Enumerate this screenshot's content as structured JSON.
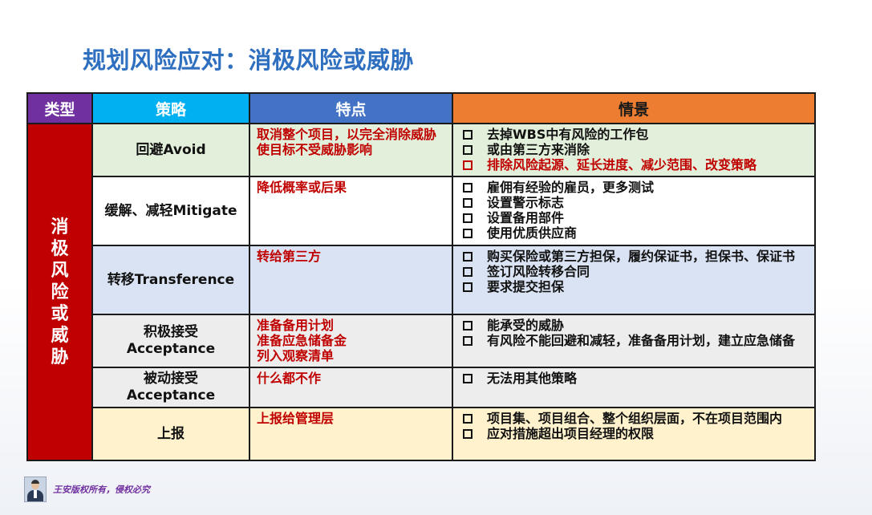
{
  "title": "规划风险应对：消极风险或威胁",
  "table": {
    "headers": {
      "type": "类型",
      "strategy": "策略",
      "feature": "特点",
      "scenario": "情景"
    },
    "type_label": "消极风险或威胁",
    "rows": [
      {
        "strategy": "回避Avoid",
        "features": [
          "取消整个项目，以完全消除威胁",
          "使目标不受威胁影响"
        ],
        "scenarios": [
          {
            "text": "去掉WBS中有风险的工作包",
            "highlight": false
          },
          {
            "text": "或由第三方来消除",
            "highlight": false
          },
          {
            "text": "排除风险起源、延长进度、减少范围、改变策略",
            "highlight": true
          }
        ]
      },
      {
        "strategy": "缓解、减轻Mitigate",
        "features": [
          "降低概率或后果"
        ],
        "scenarios": [
          {
            "text": "雇佣有经验的雇员，更多测试"
          },
          {
            "text": "设置警示标志"
          },
          {
            "text": "设置备用部件"
          },
          {
            "text": "使用优质供应商"
          }
        ]
      },
      {
        "strategy": "转移Transference",
        "features": [
          "转给第三方"
        ],
        "scenarios": [
          {
            "text": "购买保险或第三方担保，履约保证书，担保书、保证书"
          },
          {
            "text": "签订风险转移合同"
          },
          {
            "text": "要求提交担保"
          }
        ]
      },
      {
        "strategy_line1": "积极接受",
        "strategy_line2": "Acceptance",
        "features": [
          "准备备用计划",
          "准备应急储备金",
          "列入观察清单"
        ],
        "scenarios": [
          {
            "text": "能承受的威胁"
          },
          {
            "text": "有风险不能回避和减轻，准备备用计划，建立应急储备"
          }
        ]
      },
      {
        "strategy_line1": "被动接受",
        "strategy_line2": "Acceptance",
        "features": [
          "什么都不作"
        ],
        "scenarios": [
          {
            "text": "无法用其他策略"
          }
        ]
      },
      {
        "strategy": "上报",
        "features": [
          "上报给管理层"
        ],
        "scenarios": [
          {
            "text": "项目集、项目组合、整个组织层面，不在项目范围内"
          },
          {
            "text": "应对措施超出项目经理的权限"
          }
        ]
      }
    ]
  },
  "footer": {
    "copyright": "王安版权所有，侵权必究"
  },
  "colors": {
    "title": "#2f6fc0",
    "type_header": "#7030a0",
    "strategy_header": "#00b0f0",
    "feature_header": "#4472c4",
    "scenario_header": "#ed7d31",
    "type_cell": "#c00000",
    "feature_text": "#c00000"
  }
}
